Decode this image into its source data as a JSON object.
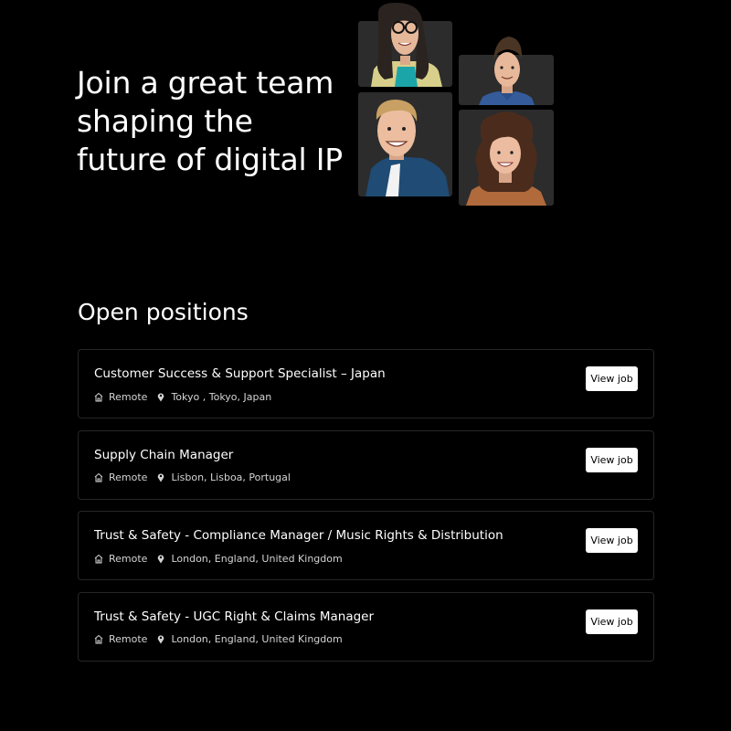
{
  "hero": {
    "title": "Join a great team shaping the future of digital IP"
  },
  "team_portraits": [
    {
      "icon": "avatar-woman-glasses"
    },
    {
      "icon": "avatar-man-blue-shirt"
    },
    {
      "icon": "avatar-man-smiling"
    },
    {
      "icon": "avatar-woman-curly-hair"
    }
  ],
  "positions": {
    "heading": "Open positions",
    "jobs": [
      {
        "title": "Customer Success & Support Specialist – Japan",
        "workplace": "Remote",
        "location": "Tokyo , Tokyo, Japan",
        "button": "View job"
      },
      {
        "title": "Supply Chain Manager",
        "workplace": "Remote",
        "location": "Lisbon, Lisboa, Portugal",
        "button": "View job"
      },
      {
        "title": "Trust & Safety - Compliance Manager / Music Rights & Distribution",
        "workplace": "Remote",
        "location": "London, England, United Kingdom",
        "button": "View job"
      },
      {
        "title": "Trust & Safety - UGC Right & Claims Manager",
        "workplace": "Remote",
        "location": "London, England, United Kingdom",
        "button": "View job"
      }
    ]
  },
  "colors": {
    "background": "#000000",
    "text": "#ffffff",
    "card_border": "#262626",
    "button_bg": "#ffffff",
    "button_text": "#000000"
  },
  "icons": {
    "workplace": "home-icon",
    "location": "map-pin-icon"
  }
}
